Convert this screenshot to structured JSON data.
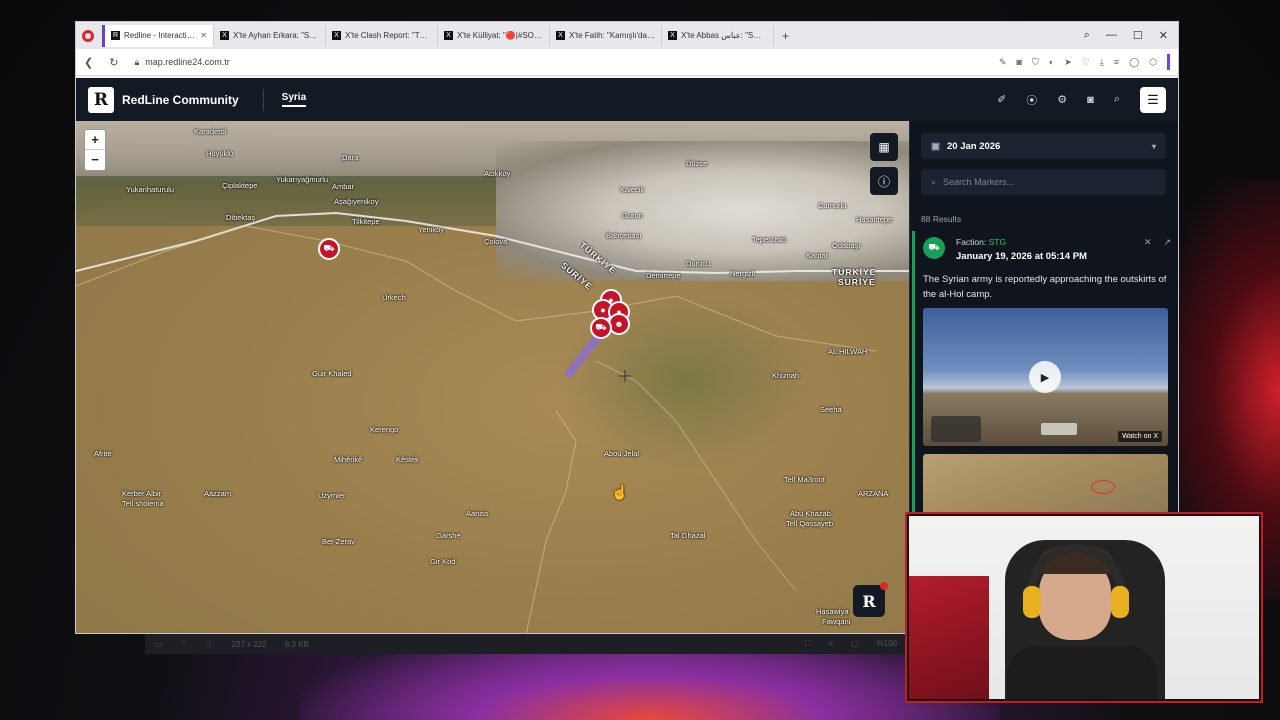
{
  "browser": {
    "tabs": [
      {
        "label": "Redline - Interactive Strat",
        "active": true
      },
      {
        "label": "X'te Ayhan Erkara: \"Suriye",
        "active": false
      },
      {
        "label": "X'te Clash Report: \"The Sy",
        "active": false
      },
      {
        "label": "X'te Külliyat: \"🔴|#SONDA",
        "active": false
      },
      {
        "label": "X'te Fatih: \"Kamışlı'da top",
        "active": false
      },
      {
        "label": "X'te Abbas عباس: \"SDF's w",
        "active": false
      }
    ],
    "url": "map.redline24.com.tr"
  },
  "app": {
    "brand": "RedLine Community",
    "logo_letter": "R",
    "region": "Syria"
  },
  "map": {
    "labels": [
      {
        "text": "Karaderdi"
      },
      {
        "text": "Hüyüklü"
      },
      {
        "text": "Dara"
      },
      {
        "text": "Düzce"
      },
      {
        "text": "Yukarıyağmurlu"
      },
      {
        "text": "Yukanhaturulu"
      },
      {
        "text": "Çiplaktepe"
      },
      {
        "text": "Ambar"
      },
      {
        "text": "Aşağıyenikoy"
      },
      {
        "text": "Acıkkoy"
      },
      {
        "text": "Kalecik"
      },
      {
        "text": "Gurun"
      },
      {
        "text": "Cumurlu"
      },
      {
        "text": "Hasantepe"
      },
      {
        "text": "Dibektaş"
      },
      {
        "text": "Tilkitepe"
      },
      {
        "text": "Yenikoy"
      },
      {
        "text": "Çolova"
      },
      {
        "text": "Bahçebaşı"
      },
      {
        "text": "Tepecüstü"
      },
      {
        "text": "Odabaşı"
      },
      {
        "text": "Kantar"
      },
      {
        "text": "Durucu"
      },
      {
        "text": "Demirtepe"
      },
      {
        "text": "Nergizli"
      },
      {
        "text": "TÜRKİYE"
      },
      {
        "text": "SURİYE"
      },
      {
        "text": "TÜRKİYE"
      },
      {
        "text": "SURİYE"
      },
      {
        "text": "Urkech"
      },
      {
        "text": "Guir Khaled"
      },
      {
        "text": "Kerengo"
      },
      {
        "text": "Afrite"
      },
      {
        "text": "Mihêrikê"
      },
      {
        "text": "Kêstek"
      },
      {
        "text": "Abou Jelal"
      },
      {
        "text": "Khiznah"
      },
      {
        "text": "Seeha"
      },
      {
        "text": "AL HILWAH"
      },
      {
        "text": "Kerber Albir"
      },
      {
        "text": "Tell sholema"
      },
      {
        "text": "Aazzam"
      },
      {
        "text": "Uzymler"
      },
      {
        "text": "Aaniss"
      },
      {
        "text": "Garshe"
      },
      {
        "text": "Ber Zerav"
      },
      {
        "text": "Gir Kod"
      },
      {
        "text": "Tal Ghazal"
      },
      {
        "text": "Abu Khazab"
      },
      {
        "text": "Tell Qassayeb"
      },
      {
        "text": "Tell Ma3roof"
      },
      {
        "text": "ARZANA"
      },
      {
        "text": "Hasawiya"
      },
      {
        "text": "Fawqani"
      }
    ],
    "zoom_in": "+",
    "zoom_out": "−"
  },
  "panel": {
    "date": "20 Jan 2026",
    "search_placeholder": "Search Markers...",
    "results": "88 Results",
    "card": {
      "faction_prefix": "Faction: ",
      "faction": "STG",
      "datetime": "January 19, 2026 at 05:14 PM",
      "text": "The Syrian army is reportedly approaching the outskirts of the al-Hol camp.",
      "watch_label": "Watch on X"
    }
  },
  "statusbar": {
    "dims": "227 x 222",
    "size": "6.3 KB",
    "zoom": "%100"
  },
  "colors": {
    "accent_red": "#c4142a",
    "faction_green": "#18a05a",
    "header_bg": "#141a24"
  }
}
